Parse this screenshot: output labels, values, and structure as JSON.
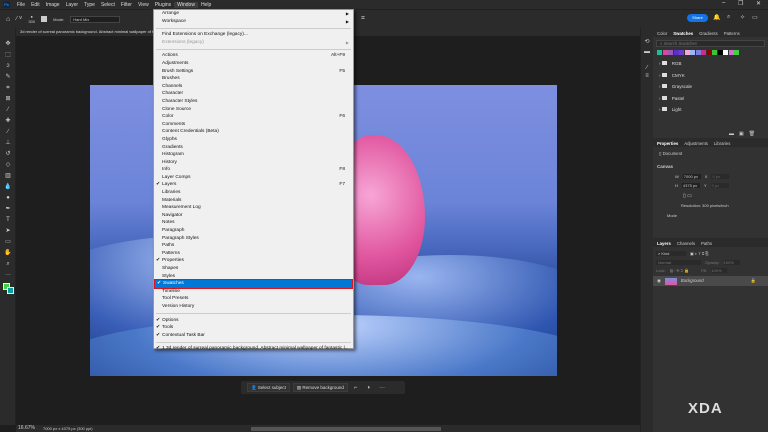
{
  "app": {
    "logo": "Ps",
    "menus": [
      "File",
      "Edit",
      "Image",
      "Layer",
      "Type",
      "Select",
      "Filter",
      "View",
      "Plugins",
      "Window",
      "Help"
    ],
    "active_menu": "Window",
    "share": "Share"
  },
  "options": {
    "brush_size": "300",
    "mode_label": "Mode:",
    "mode_value": "Hard Mix"
  },
  "document_tab": {
    "title": "3d render of surreal panoramic background. Abstract minimal wallpaper of fantastic landscape - jpeg.jpeg @ 16.7% (RGB/8#) *"
  },
  "window_menu": {
    "group1": [
      {
        "label": "Arrange",
        "submenu": true
      },
      {
        "label": "Workspace",
        "submenu": true
      }
    ],
    "group2": [
      {
        "label": "Find Extensions on Exchange (legacy)..."
      },
      {
        "label": "Extensions (legacy)",
        "submenu": true,
        "disabled": true
      }
    ],
    "group3": [
      {
        "label": "Actions",
        "shortcut": "Alt+F9"
      },
      {
        "label": "Adjustments"
      },
      {
        "label": "Brush Settings",
        "shortcut": "F5"
      },
      {
        "label": "Brushes"
      },
      {
        "label": "Channels"
      },
      {
        "label": "Character"
      },
      {
        "label": "Character Styles"
      },
      {
        "label": "Clone Source"
      },
      {
        "label": "Color",
        "shortcut": "F6"
      },
      {
        "label": "Comments"
      },
      {
        "label": "Content Credentials (Beta)"
      },
      {
        "label": "Glyphs"
      },
      {
        "label": "Gradients"
      },
      {
        "label": "Histogram"
      },
      {
        "label": "History"
      },
      {
        "label": "Info",
        "shortcut": "F8"
      },
      {
        "label": "Layer Comps"
      },
      {
        "label": "Layers",
        "shortcut": "F7",
        "checked": true
      },
      {
        "label": "Libraries"
      },
      {
        "label": "Materials"
      },
      {
        "label": "Measurement Log"
      },
      {
        "label": "Navigator"
      },
      {
        "label": "Notes"
      },
      {
        "label": "Paragraph"
      },
      {
        "label": "Paragraph Styles"
      },
      {
        "label": "Paths"
      },
      {
        "label": "Patterns"
      },
      {
        "label": "Properties",
        "checked": true
      },
      {
        "label": "Shapes"
      },
      {
        "label": "Styles"
      },
      {
        "label": "Swatches",
        "checked": true,
        "highlighted": true
      },
      {
        "label": "Timeline"
      },
      {
        "label": "Tool Presets"
      },
      {
        "label": "Version History"
      }
    ],
    "group4": [
      {
        "label": "Options",
        "checked": true
      },
      {
        "label": "Tools",
        "checked": true
      },
      {
        "label": "Contextual Task Bar",
        "checked": true
      }
    ],
    "group5": [
      {
        "label": "1 3d render of surreal panoramic background. Abstract minimal wallpaper of fantastic l...",
        "checked": true
      }
    ]
  },
  "swatches_panel": {
    "tabs": [
      "Color",
      "Swatches",
      "Gradients",
      "Patterns"
    ],
    "active": "Swatches",
    "search_placeholder": "Search Swatches",
    "colors": [
      "#1abc9c",
      "#d946a0",
      "#9b59b6",
      "#5b2fc9",
      "#6a3fd0",
      "#f7a6d6",
      "#a0b4f0",
      "#7a7fe0",
      "#d02a8a",
      "#8b0000",
      "#3ac43a",
      "#000000",
      "#ffffff",
      "#d070d0",
      "#40d040"
    ],
    "folders": [
      "RGB",
      "CMYK",
      "Grayscale",
      "Pastel",
      "Light"
    ]
  },
  "properties_panel": {
    "tabs": [
      "Properties",
      "Adjustments",
      "Libraries"
    ],
    "active": "Properties",
    "doc_label": "Document",
    "section": "Canvas",
    "w_label": "W",
    "w_value": "7000 px",
    "h_label": "H",
    "h_value": "4375 px",
    "x_label": "X",
    "x_value": "0 px",
    "y_label": "Y",
    "y_value": "0 px",
    "resolution": "Resolution: 300 pixels/inch",
    "mode_label": "Mode"
  },
  "layers_panel": {
    "tabs": [
      "Layers",
      "Channels",
      "Paths"
    ],
    "active": "Layers",
    "filter_placeholder": "Kind",
    "blend": "Normal",
    "opacity_label": "Opacity:",
    "opacity": "100%",
    "lock_label": "Lock:",
    "fill_label": "Fill:",
    "fill": "100%",
    "layers": [
      {
        "name": "Background",
        "visible": true,
        "locked": true
      }
    ]
  },
  "contextual_bar": {
    "select_subject": "Select subject",
    "remove_background": "Remove background",
    "more": "···"
  },
  "status": {
    "zoom": "16.67%",
    "doc_info": "7000 px x 4375 px (300 ppi)"
  },
  "watermark": "XDA"
}
